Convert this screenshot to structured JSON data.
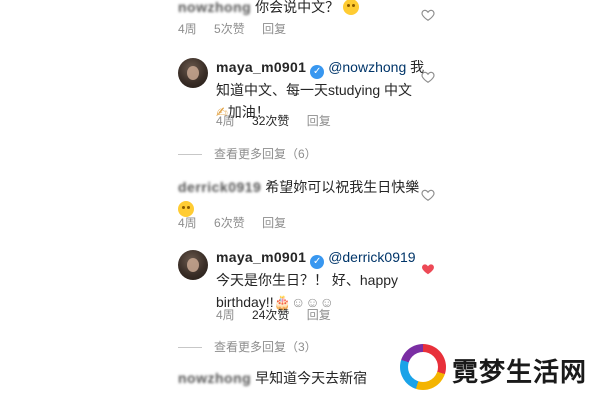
{
  "comments": [
    {
      "user": "nowzhong",
      "text": "你会说中文？",
      "time": "4周",
      "likes": "5次赞",
      "reply": "回复"
    },
    {
      "user": "maya_m0901",
      "mention": "@nowzhong",
      "text_line1": "我",
      "text_line2": "知道中文、每一天studying 中文",
      "text_line3": "加油！",
      "time": "4周",
      "likes": "32次赞",
      "reply": "回复"
    },
    {
      "more_replies": "查看更多回复（6）"
    },
    {
      "user": "derrick0919",
      "text": "希望妳可以祝我生日快樂",
      "time": "4周",
      "likes": "6次赞",
      "reply": "回复"
    },
    {
      "user": "maya_m0901",
      "mention": "@derrick0919",
      "text_line2": "今天是你生日？！ 好、happy",
      "text_line3": "birthday!!",
      "time": "4周",
      "likes": "24次赞",
      "reply": "回复"
    },
    {
      "more_replies": "查看更多回复（3）"
    },
    {
      "user": "nowzhong",
      "text": "早知道今天去新宿"
    }
  ],
  "watermark": {
    "text": "霓梦生活网"
  },
  "colors": {
    "verified": "#3897f0",
    "liked_heart": "#ed4956",
    "meta": "#8e8e8e"
  }
}
